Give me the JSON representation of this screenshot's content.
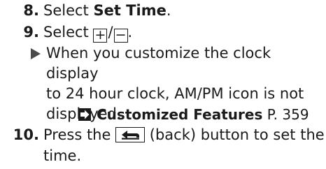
{
  "steps": [
    {
      "number": "8.",
      "pre": "Select ",
      "bold": "Set Time",
      "post": "."
    },
    {
      "number": "9.",
      "pre": "Select ",
      "plus_icon": "+",
      "separator": "/",
      "minus_icon": "−",
      "post": "."
    },
    {
      "number": "10.",
      "pre": "Press the ",
      "button_icon": "back-icon",
      "mid": " (back) button to set the",
      "cont": "time."
    }
  ],
  "note": {
    "line1": "When you customize the clock display",
    "line2": "to 24 hour clock, AM/PM icon is not",
    "line3": "displayed."
  },
  "xref": {
    "title": "Customized Features",
    "page": "P. 359"
  }
}
